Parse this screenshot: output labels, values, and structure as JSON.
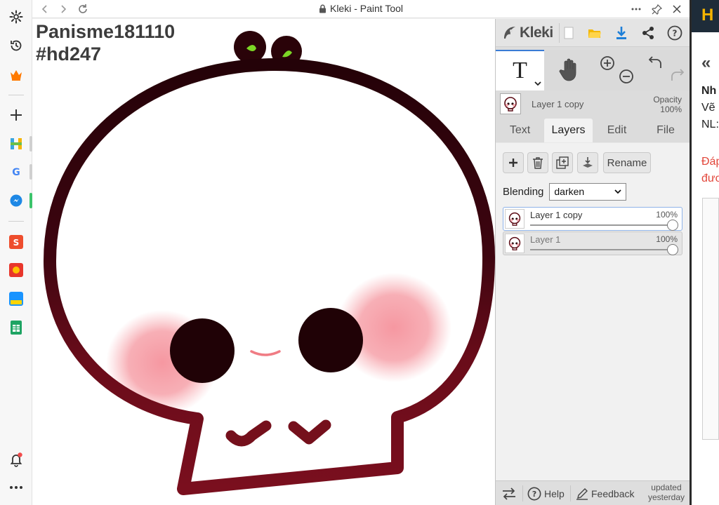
{
  "window": {
    "title": "Kleki - Paint Tool"
  },
  "canvas": {
    "text_line1": "Panisme181110",
    "text_line2": "#hd247"
  },
  "kleki": {
    "logo_text": "Kleki",
    "current_layer": {
      "name": "Layer 1 copy",
      "opacity_label": "Opacity",
      "opacity_value": "100%"
    },
    "tabs": [
      "Text",
      "Layers",
      "Edit",
      "File"
    ],
    "active_tab": "Layers",
    "rename_label": "Rename",
    "blending_label": "Blending",
    "blending_value": "darken",
    "layers": [
      {
        "name": "Layer 1 copy",
        "opacity": "100%",
        "opacity_value": 100,
        "active": true
      },
      {
        "name": "Layer 1",
        "opacity": "100%",
        "opacity_value": 100,
        "active": false
      }
    ],
    "footer": {
      "help_label": "Help",
      "feedback_label": "Feedback",
      "updated_line1": "updated",
      "updated_line2": "yesterday"
    }
  },
  "background_page": {
    "lines": [
      "«",
      "Nh",
      "Vẽ",
      "NL:",
      "Đáp",
      "đươ"
    ]
  },
  "colors": {
    "accent": "#3a7bd5",
    "outline": "#5a0a14",
    "blush": "#f59aa3"
  }
}
